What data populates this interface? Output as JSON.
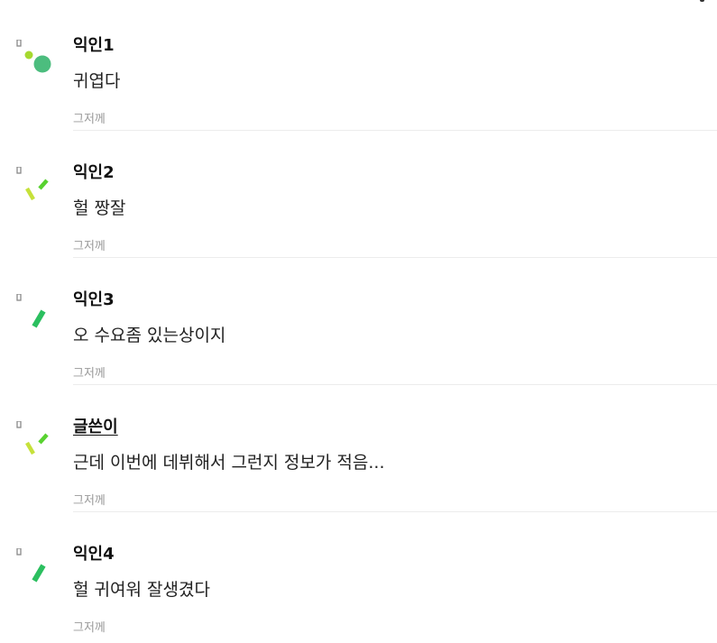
{
  "comments": [
    {
      "author": "익인1",
      "text": "귀엽다",
      "meta": "그저께",
      "avatar_icon": "dots-avatar-icon",
      "avatar_colors": [
        "#a6d92f",
        "#4cbd7e"
      ]
    },
    {
      "author": "익인2",
      "text": "헐 짱잘",
      "meta": "그저께",
      "avatar_icon": "slashes-avatar-icon",
      "avatar_colors": [
        "#c6e13a",
        "#58d230"
      ]
    },
    {
      "author": "익인3",
      "text": "오 수요좀 있는상이지",
      "meta": "그저께",
      "avatar_icon": "bar-avatar-icon",
      "avatar_colors": [
        "#2bbf5f"
      ]
    },
    {
      "author": "글쓴이",
      "text": "근데 이번에 데뷔해서 그런지 정보가 적음...",
      "meta": "그저께",
      "avatar_icon": "slashes-avatar-icon",
      "avatar_colors": [
        "#c6e13a",
        "#58d230"
      ]
    },
    {
      "author": "익인4",
      "text": "헐 귀여워 잘생겼다",
      "meta": "그저께",
      "avatar_icon": "bar-avatar-icon",
      "avatar_colors": [
        "#2bbf5f"
      ]
    }
  ]
}
